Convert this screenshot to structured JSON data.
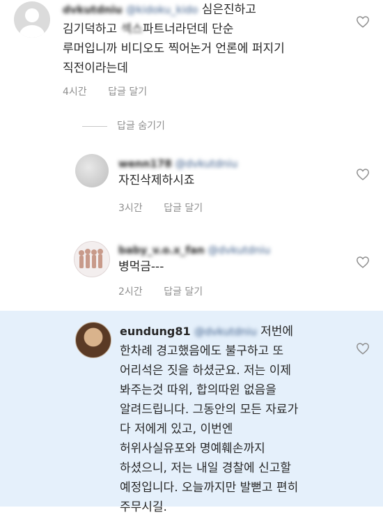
{
  "comments": [
    {
      "username": "dvkutdniu",
      "mention": "@kidoku_kido",
      "lines": [
        "심은진하고",
        "김기덕하고 섹스파트너라던데 단순",
        "루머입니까 비디오도 찍어논거 언론에 퍼지기",
        "직전이라는데"
      ],
      "time": "4시간",
      "reply": "답글 달기"
    },
    {
      "username": "wenn178",
      "mention": "@dvkutdniu",
      "lines": [
        "자진삭제하시죠"
      ],
      "time": "3시간",
      "reply": "답글 달기"
    },
    {
      "username": "baby_v.o.x_fan",
      "mention": "@dvkutdniu",
      "lines": [
        "병먹금---"
      ],
      "time": "2시간",
      "reply": "답글 달기"
    },
    {
      "username": "eundung81",
      "mention": "@dvkutdniu",
      "lines": [
        "저번에",
        "한차례 경고했음에도 불구하고 또",
        "어리석은 짓을 하셨군요. 저는 이제",
        "봐주는것 따위, 합의따윈 없음을",
        "알려드립니다. 그동안의 모든 자료가",
        "다 저에게 있고, 이번엔",
        "허위사실유포와 명예훼손까지",
        "하셨으니, 저는 내일 경찰에 신고할",
        "예정입니다. 오늘까지만 발뻗고 편히",
        "주무시길."
      ]
    }
  ],
  "hide_replies": "답글 숨기기",
  "colors": {
    "highlight": "#e5f0fb",
    "mention": "#3d5e8a",
    "meta": "#8e8e8e"
  },
  "icons": {
    "like": "heart-outline-icon"
  }
}
